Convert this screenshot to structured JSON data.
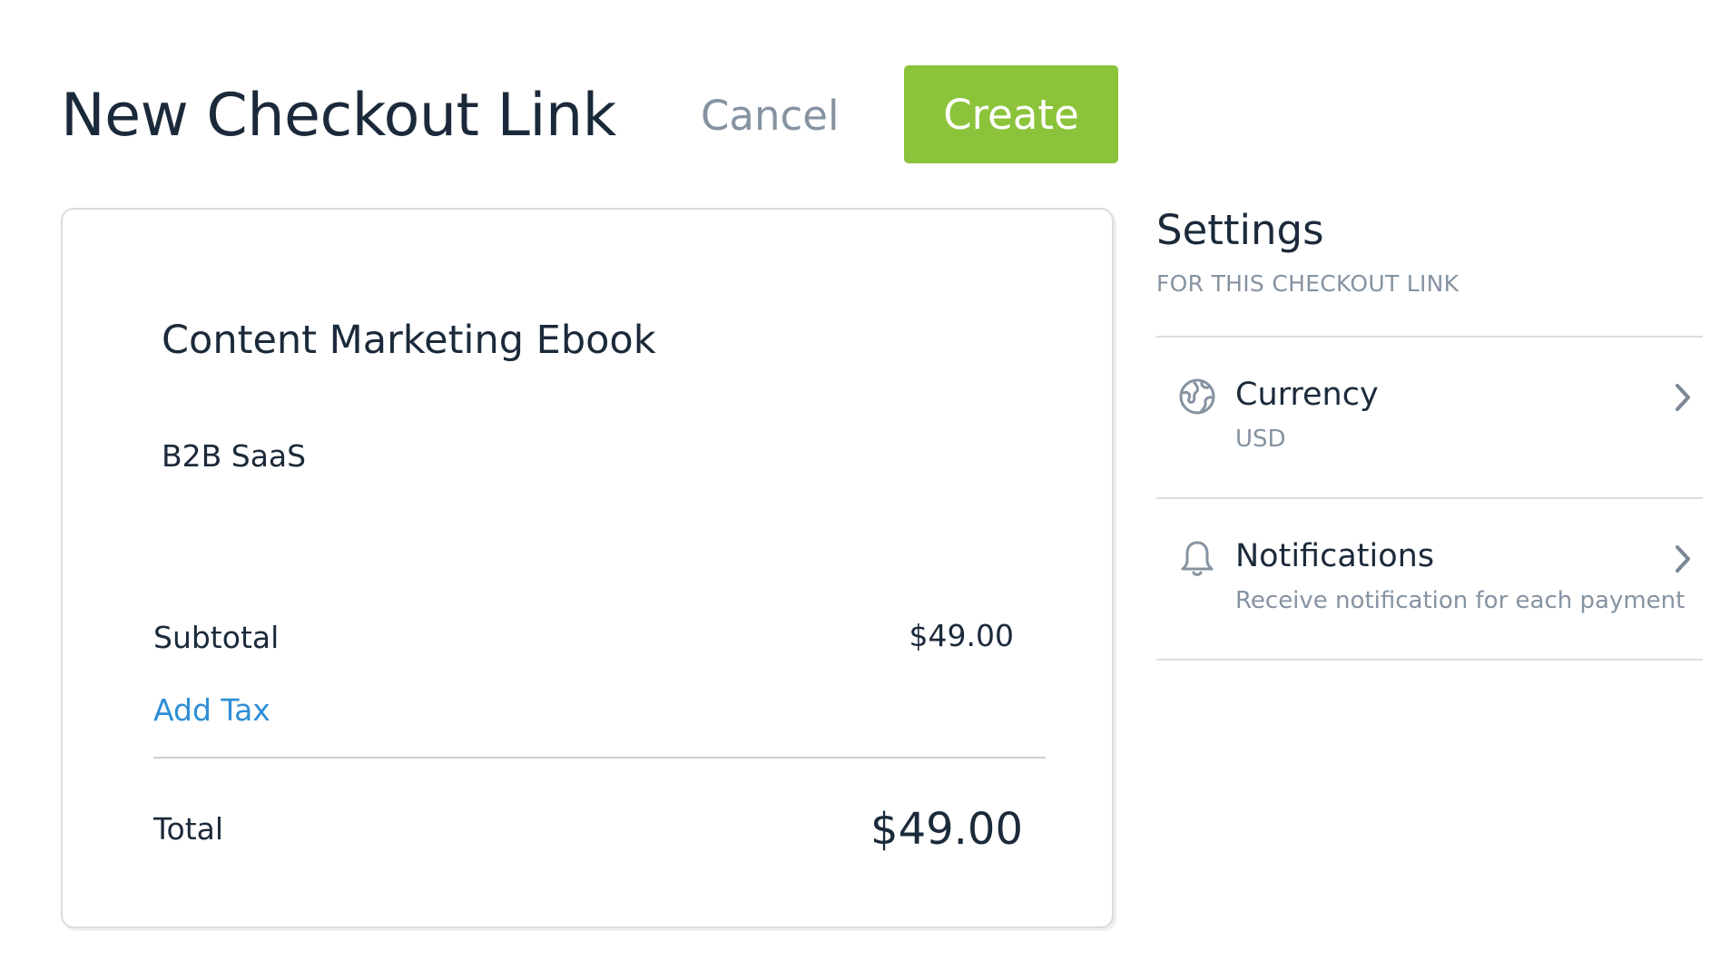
{
  "header": {
    "title": "New Checkout Link",
    "cancel_label": "Cancel",
    "create_label": "Create"
  },
  "product": {
    "name": "Content Marketing Ebook",
    "description": "B2B SaaS"
  },
  "summary": {
    "subtotal_label": "Subtotal",
    "subtotal_value": "$49.00",
    "add_tax_label": "Add Tax",
    "total_label": "Total",
    "total_value": "$49.00"
  },
  "settings": {
    "title": "Settings",
    "subtitle": "FOR THIS CHECKOUT LINK",
    "items": [
      {
        "label": "Currency",
        "value": "USD",
        "icon": "globe-icon"
      },
      {
        "label": "Notifications",
        "value": "Receive notification for each payment",
        "icon": "bell-icon"
      }
    ]
  },
  "colors": {
    "accent_green": "#8bc43a",
    "link_blue": "#2d8fd5",
    "text_dark": "#1b2a3a",
    "text_muted": "#8593a1",
    "border": "#d9dde1"
  }
}
